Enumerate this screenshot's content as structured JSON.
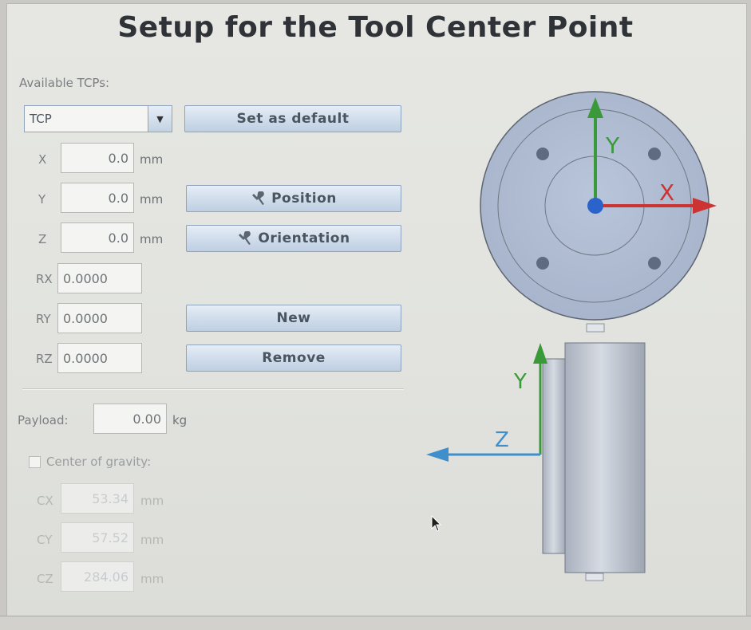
{
  "title": "Setup for the Tool Center Point",
  "available_label": "Available TCPs:",
  "tcp_select": {
    "value": "TCP",
    "arrow": "▼"
  },
  "buttons": {
    "set_default": "Set as default",
    "position": "Position",
    "orientation": "Orientation",
    "new": "New",
    "remove": "Remove"
  },
  "coords": [
    {
      "label": "X",
      "value": "0.0",
      "unit": "mm"
    },
    {
      "label": "Y",
      "value": "0.0",
      "unit": "mm"
    },
    {
      "label": "Z",
      "value": "0.0",
      "unit": "mm"
    },
    {
      "label": "RX",
      "value": "0.0000"
    },
    {
      "label": "RY",
      "value": "0.0000"
    },
    {
      "label": "RZ",
      "value": "0.0000"
    }
  ],
  "payload": {
    "label": "Payload:",
    "value": "0.00",
    "unit": "kg"
  },
  "center_of_gravity": {
    "label": "Center of gravity:",
    "checked": false,
    "fields": [
      {
        "label": "CX",
        "value": "53.34",
        "unit": "mm"
      },
      {
        "label": "CY",
        "value": "57.52",
        "unit": "mm"
      },
      {
        "label": "CZ",
        "value": "284.06",
        "unit": "mm"
      }
    ]
  },
  "diagram": {
    "top_view_axes": {
      "x": "X",
      "y": "Y"
    },
    "side_view_axes": {
      "y": "Y",
      "z": "Z"
    },
    "colors": {
      "x_axis": "#cc3333",
      "y_axis": "#3a9a3a",
      "z_axis": "#3f8fcc",
      "origin": "#2a63c9"
    }
  },
  "icons": {
    "tool": "wrench-icon",
    "cursor": "mouse-cursor-icon"
  }
}
